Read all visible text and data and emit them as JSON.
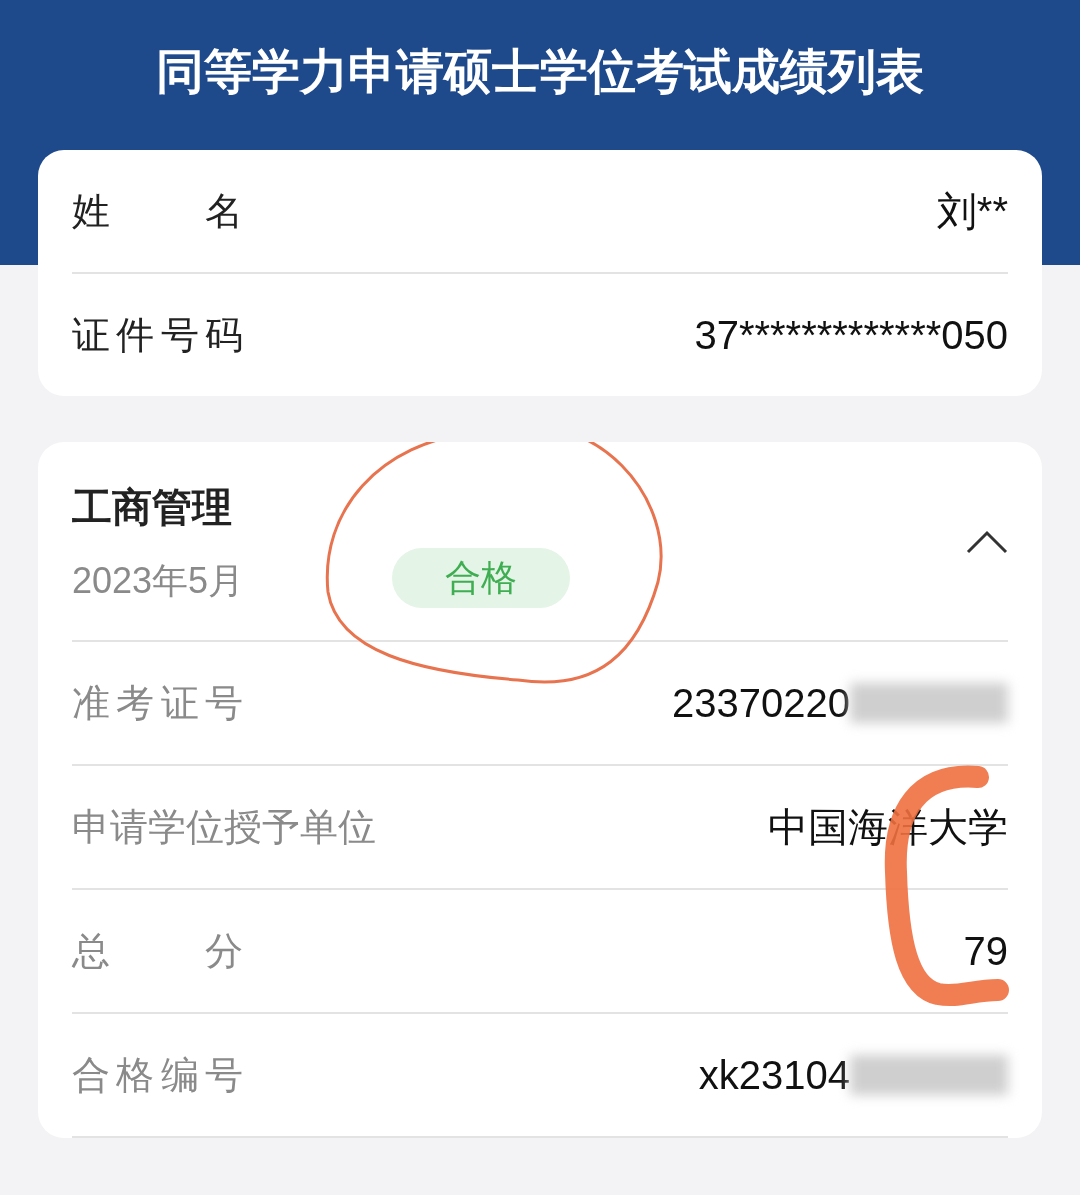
{
  "header": {
    "title": "同等学力申请硕士学位考试成绩列表"
  },
  "identity": [
    {
      "label": "姓名",
      "value": "刘**"
    },
    {
      "label": "证件号码",
      "value": "37*************050"
    }
  ],
  "exam": {
    "subject": "工商管理",
    "date": "2023年5月",
    "status": "合格",
    "expanded": true,
    "rows": [
      {
        "label": "准考证号",
        "value": "23370220",
        "masked": true
      },
      {
        "label": "申请学位授予单位",
        "value": "中国海洋大学",
        "masked": false
      },
      {
        "label": "总分",
        "value": "79",
        "masked": false
      },
      {
        "label": "合格编号",
        "value": "xk23104",
        "masked": true
      }
    ]
  }
}
